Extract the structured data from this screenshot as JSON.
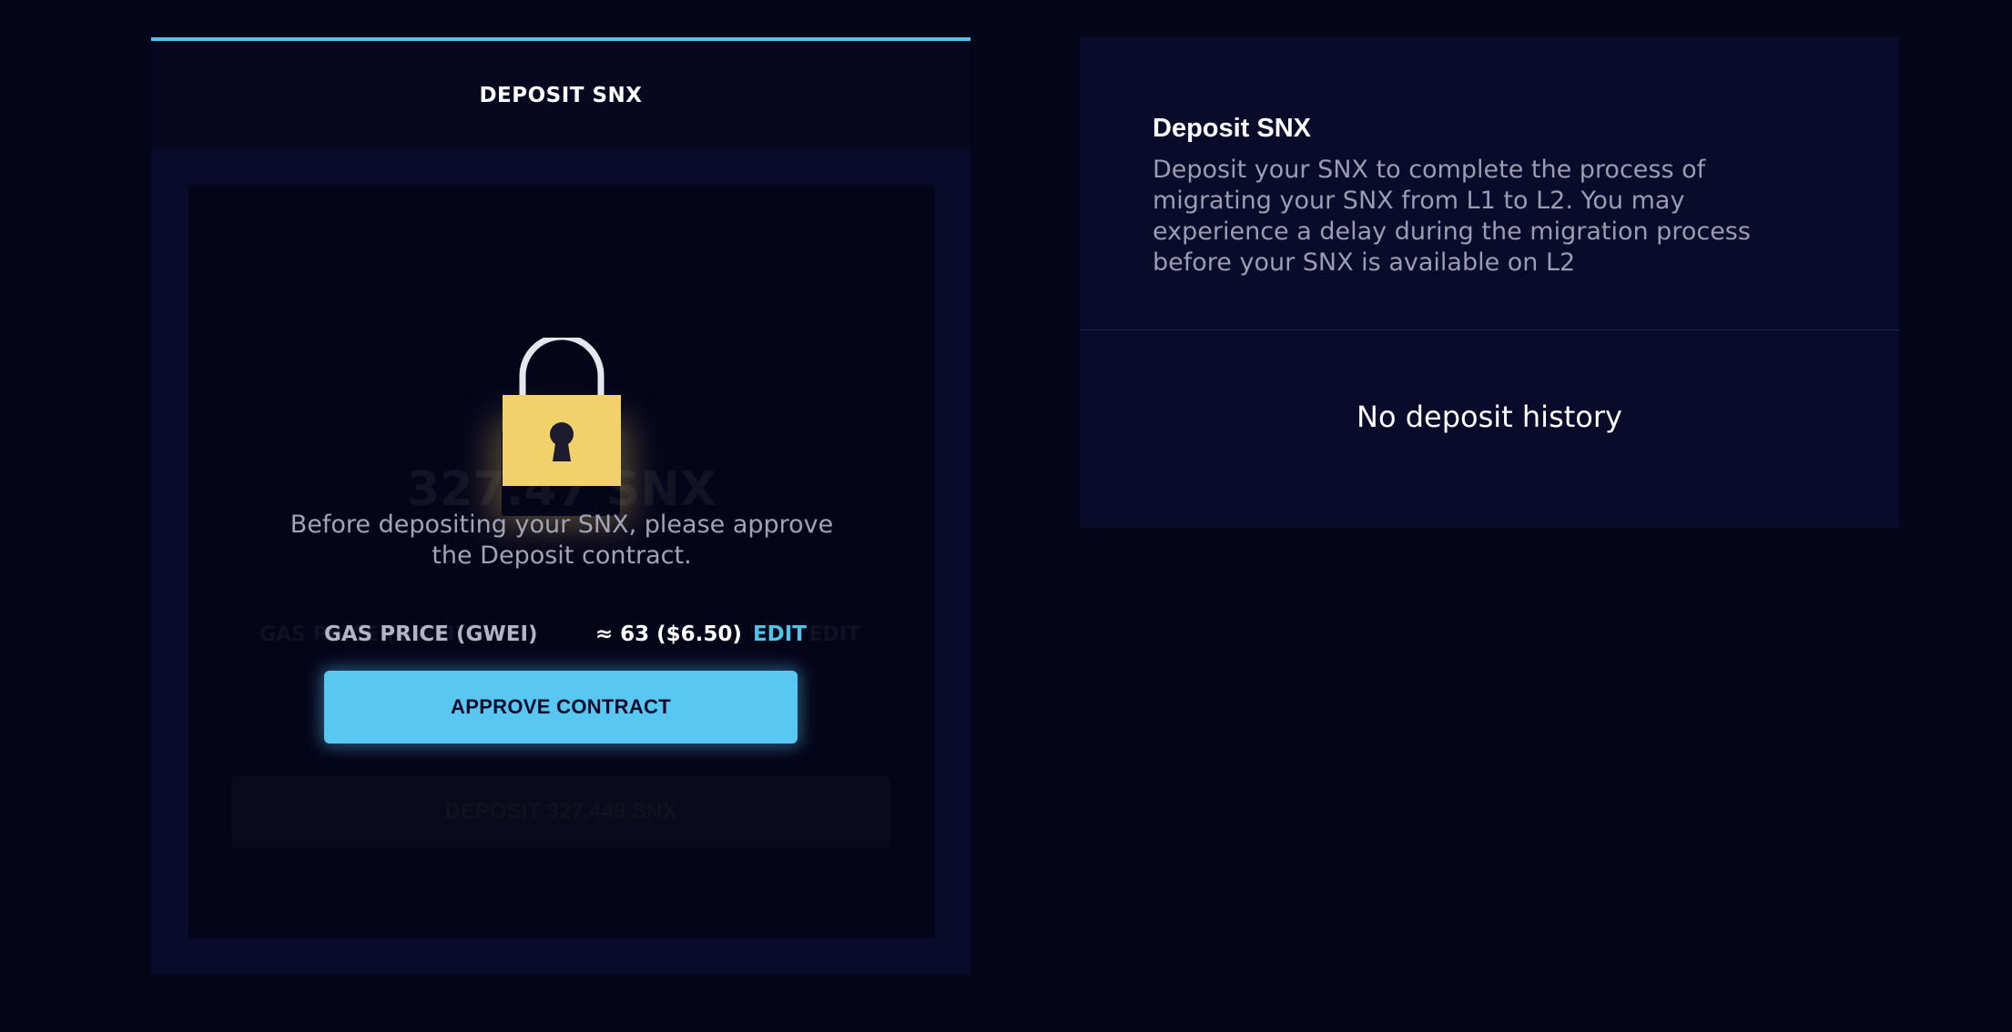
{
  "deposit_panel": {
    "title": "DEPOSIT SNX",
    "background_amount": "327.47 SNX",
    "background_gas_label": "GAS PRICE (GWEI)",
    "background_gas_edit": "EDIT",
    "background_button_label": "DEPOSIT 327.449 SNX",
    "lock_icon": "lock-icon",
    "approve_message": "Before depositing your SNX, please approve the Deposit contract.",
    "gas_label": "GAS PRICE (GWEI)",
    "gas_value": "≈ 63 ($6.50)",
    "gas_edit_label": "EDIT",
    "approve_button_label": "APPROVE CONTRACT"
  },
  "info_panel": {
    "title": "Deposit SNX",
    "description": "Deposit your SNX to complete the process of migrating your SNX from L1 to L2. You may experience a delay during the migration process before your SNX is available on L2",
    "history_empty": "No deposit history"
  },
  "colors": {
    "page_background": "#06061a",
    "card_background": "#0a0a2b",
    "accent": "#4fc3e8",
    "button": "#58c8f2",
    "lock_body": "#f2d06a"
  }
}
